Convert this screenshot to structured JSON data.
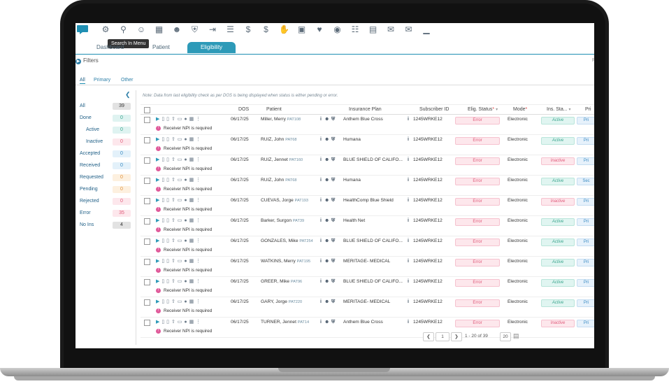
{
  "toolbar": {
    "tooltip": "Search In Menu",
    "icons": [
      "flag-icon",
      "gear-icon",
      "search-icon",
      "user-icon",
      "calendar-icon",
      "user-lock-icon",
      "shield-check-icon",
      "arrow-in-icon",
      "document-icon",
      "dollar-doc-icon",
      "dollar-exchange-icon",
      "hand-money-icon",
      "inbox-icon",
      "hands-heart-icon",
      "money-bag-icon",
      "receipt-icon",
      "book-icon",
      "envelope-icon",
      "money-envelope-icon",
      "chart-icon"
    ]
  },
  "tabs": {
    "dashboard": "Dashboard",
    "patient": "Patient",
    "eligibility": "Eligibility"
  },
  "filters": {
    "label": "Filters",
    "right_label": "R"
  },
  "subtabs": [
    "All",
    "Primary",
    "Other"
  ],
  "sidebar": [
    {
      "label": "All",
      "count": "39",
      "bg": "#e2e2e2",
      "fg": "#333333",
      "indent": false
    },
    {
      "label": "Done",
      "count": "0",
      "bg": "#dff3f1",
      "fg": "#3aa58d",
      "indent": false
    },
    {
      "label": "Active",
      "count": "0",
      "bg": "#dff3f1",
      "fg": "#3aa58d",
      "indent": true
    },
    {
      "label": "Inactive",
      "count": "0",
      "bg": "#fde7ec",
      "fg": "#e05a7a",
      "indent": true
    },
    {
      "label": "Accepted",
      "count": "0",
      "bg": "#e3f1fa",
      "fg": "#3a8bc2",
      "indent": false
    },
    {
      "label": "Received",
      "count": "0",
      "bg": "#e3f1fa",
      "fg": "#3a8bc2",
      "indent": false
    },
    {
      "label": "Requested",
      "count": "0",
      "bg": "#fdf0df",
      "fg": "#e0913a",
      "indent": false
    },
    {
      "label": "Pending",
      "count": "0",
      "bg": "#fdf0df",
      "fg": "#e0913a",
      "indent": false
    },
    {
      "label": "Rejected",
      "count": "0",
      "bg": "#fde7ec",
      "fg": "#e05a7a",
      "indent": false
    },
    {
      "label": "Error",
      "count": "35",
      "bg": "#fde7ec",
      "fg": "#e05a7a",
      "indent": false
    },
    {
      "label": "No Ins",
      "count": "4",
      "bg": "#e2e2e2",
      "fg": "#333333",
      "indent": false
    }
  ],
  "note": "Note: Data from last eligibility check as per DOS is being displayed when status is either pending or error.",
  "columns": {
    "dos": "DOS",
    "patient": "Patient",
    "insurance_plan": "Insurance Plan",
    "subscriber_id": "Subscriber ID",
    "elig_status": "Elig. Status",
    "mode": "Mode",
    "ins_status": "Ins. Sta...",
    "priority": "Pri"
  },
  "error_message": "Receiver NPI is required",
  "rows": [
    {
      "dos": "06/17/25",
      "name": "Miller, Merry",
      "pat": "PAT108",
      "plan": "Anthem Blue Cross",
      "sub": "1245WRKE12",
      "elig": "Error",
      "mode": "Electronic",
      "ins": "Active",
      "pri": "Pri"
    },
    {
      "dos": "06/17/25",
      "name": "RUIZ, John",
      "pat": "PAT68",
      "plan": "Humana",
      "sub": "1245WRKE12",
      "elig": "Error",
      "mode": "Electronic",
      "ins": "Active",
      "pri": "Pri"
    },
    {
      "dos": "06/17/25",
      "name": "RUIZ, Jennet",
      "pat": "PAT160",
      "plan": "BLUE SHIELD OF CALIFO...",
      "sub": "1245WRKE12",
      "elig": "Error",
      "mode": "Electronic",
      "ins": "Inactive",
      "pri": "Pri"
    },
    {
      "dos": "06/17/25",
      "name": "RUIZ, John",
      "pat": "PAT68",
      "plan": "Humana",
      "sub": "1245WRKE12",
      "elig": "Error",
      "mode": "Electronic",
      "ins": "Active",
      "pri": "Sec"
    },
    {
      "dos": "06/17/25",
      "name": "CUEVAS, Jorge",
      "pat": "PAT193",
      "plan": "HealthComp Blue Shield",
      "sub": "1245WRKE12",
      "elig": "Error",
      "mode": "Electronic",
      "ins": "Inactive",
      "pri": "Pri"
    },
    {
      "dos": "06/17/25",
      "name": "Barker, Surgon",
      "pat": "PAT39",
      "plan": "Health Net",
      "sub": "1245WRKE12",
      "elig": "Error",
      "mode": "Electronic",
      "ins": "Active",
      "pri": "Pri"
    },
    {
      "dos": "06/17/25",
      "name": "GONZALES, Mike",
      "pat": "PAT254",
      "plan": "BLUE SHIELD OF CALIFO...",
      "sub": "1245WRKE12",
      "elig": "Error",
      "mode": "Electronic",
      "ins": "Active",
      "pri": "Pri"
    },
    {
      "dos": "06/17/25",
      "name": "WATKINS, Merry",
      "pat": "PAT195",
      "plan": "MERITAGE- MEDICAL",
      "sub": "1245WRKE12",
      "elig": "Error",
      "mode": "Electronic",
      "ins": "Active",
      "pri": "Pri"
    },
    {
      "dos": "06/17/25",
      "name": "GREER, Mike",
      "pat": "PAT96",
      "plan": "BLUE SHIELD OF CALIFO...",
      "sub": "1245WRKE12",
      "elig": "Error",
      "mode": "Electronic",
      "ins": "Active",
      "pri": "Pri"
    },
    {
      "dos": "06/17/25",
      "name": "GARY, Jorge",
      "pat": "PAT220",
      "plan": "MERITAGE- MEDICAL",
      "sub": "1245WRKE12",
      "elig": "Error",
      "mode": "Electronic",
      "ins": "Active",
      "pri": "Pri"
    },
    {
      "dos": "06/17/25",
      "name": "TURNER, Jennet",
      "pat": "PAT14",
      "plan": "Anthem Blue Cross",
      "sub": "1245WRKE12",
      "elig": "Error",
      "mode": "Electronic",
      "ins": "Inactive",
      "pri": "Pri"
    }
  ],
  "pager": {
    "page": "1",
    "range": "1 - 20 of 39",
    "page_size": "20"
  },
  "colors": {
    "accent": "#2d9ab8",
    "error": "#e05a7a",
    "active": "#3aa58d"
  }
}
